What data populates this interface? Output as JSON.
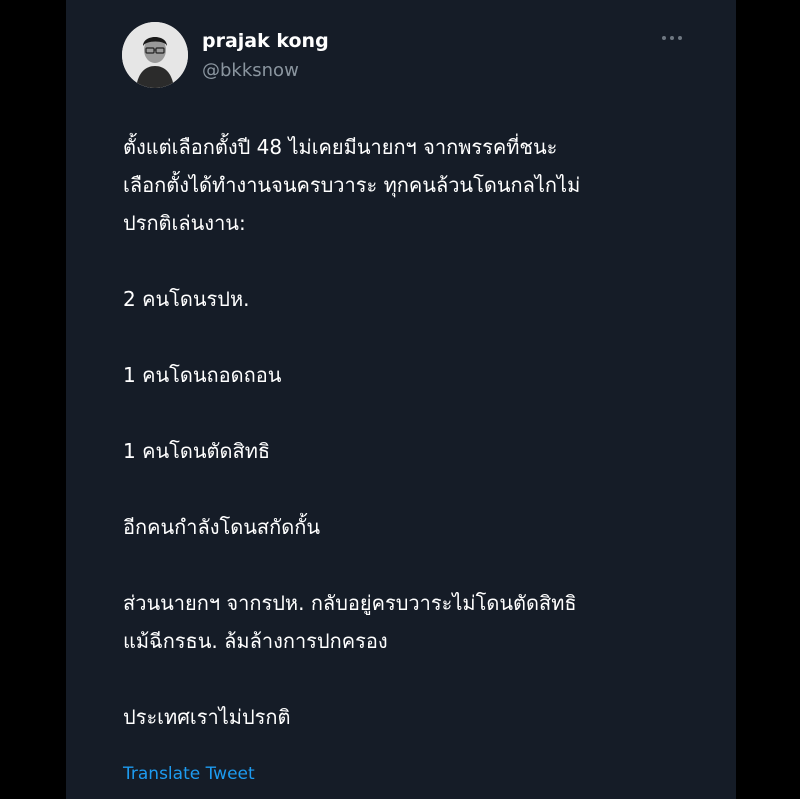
{
  "tweet": {
    "author": {
      "name": "prajak kong",
      "handle": "@bkksnow"
    },
    "more_icon": "more-horizontal-icon",
    "paragraphs": [
      "ตั้งแต่เลือกตั้งปี 48 ไม่เคยมีนายกฯ จากพรรคที่ชนะ\nเลือกตั้งได้ทำงานจนครบวาระ ทุกคนล้วนโดนกลไกไม่\nปรกติเล่นงาน:",
      "2 คนโดนรปห.",
      "1 คนโดนถอดถอน",
      "1 คนโดนตัดสิทธิ",
      "อีกคนกำลังโดนสกัดกั้น",
      "ส่วนนายกฯ จากรปห. กลับอยู่ครบวาระไม่โดนตัดสิทธิ\nแม้ฉีกรธน. ล้มล้างการปกครอง",
      "ประเทศเราไม่ปรกติ"
    ],
    "translate_label": "Translate Tweet"
  },
  "colors": {
    "background": "#000000",
    "card": "#151c27",
    "text": "#ffffff",
    "secondary_text": "#8a959f",
    "link": "#1d9bf0"
  }
}
